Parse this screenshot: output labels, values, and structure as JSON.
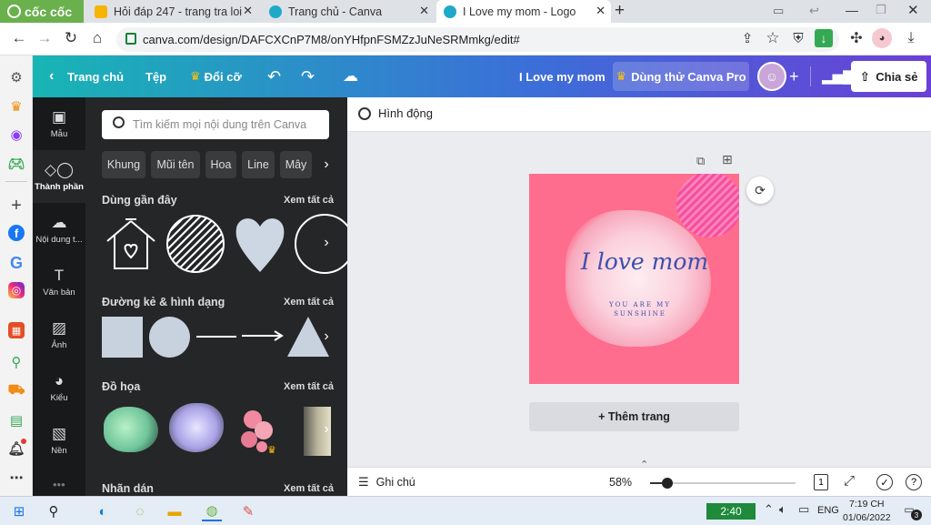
{
  "browser": {
    "brand": "cốc cốc",
    "tabs": [
      {
        "title": "Hỏi đáp 247 - trang tra loi",
        "active": false
      },
      {
        "title": "Trang chủ - Canva",
        "active": false
      },
      {
        "title": "I Love my mom - Logo",
        "active": true
      }
    ],
    "new_tab": "+",
    "url": "canva.com/design/DAFCXCnP7M8/onYHfpnFSMZzJuNeSRMmkg/edit#"
  },
  "topnav": {
    "home": "Trang chủ",
    "file": "Tệp",
    "resize": "Đổi cỡ",
    "doc_title": "I Love my mom",
    "try_pro": "Dùng thử Canva Pro",
    "share": "Chia sẻ"
  },
  "sidebar": {
    "items": [
      {
        "label": "Mẫu",
        "icon": "template-icon"
      },
      {
        "label": "Thành phần",
        "icon": "elements-icon"
      },
      {
        "label": "Nội dung t...",
        "icon": "upload-icon"
      },
      {
        "label": "Văn bản",
        "icon": "text-icon"
      },
      {
        "label": "Ảnh",
        "icon": "photo-icon"
      },
      {
        "label": "Kiểu",
        "icon": "styles-icon"
      },
      {
        "label": "Nền",
        "icon": "background-icon"
      }
    ]
  },
  "panel": {
    "search_placeholder": "Tìm kiếm mọi nội dung trên Canva",
    "chips": [
      "Khung",
      "Mũi tên",
      "Hoa",
      "Line",
      "Mây"
    ],
    "sections": {
      "recent": "Dùng gần đây",
      "lines_shapes": "Đường kẻ & hình dạng",
      "graphics": "Đồ họa",
      "stickers": "Nhãn dán"
    },
    "see_all": "Xem tất cả"
  },
  "canvas": {
    "animate": "Hình động",
    "design_title": "I love mom",
    "design_subtitle_1": "YOU ARE MY",
    "design_subtitle_2": "SUNSHINE",
    "add_page": "+ Thêm trang"
  },
  "bottombar": {
    "notes": "Ghi chú",
    "zoom": "58%",
    "page_num": "1",
    "zoom_fraction": 0.12
  },
  "taskbar": {
    "battery_time": "2:40",
    "lang": "ENG",
    "time": "7:19 CH",
    "date": "01/06/2022",
    "notif_count": "3"
  },
  "colors": {
    "canvas_bg": "#fe6d8d",
    "gradient_start": "#18b5b5",
    "gradient_end": "#6a3fd6",
    "panel_bg": "#252627",
    "title_color": "#3e4faa"
  }
}
